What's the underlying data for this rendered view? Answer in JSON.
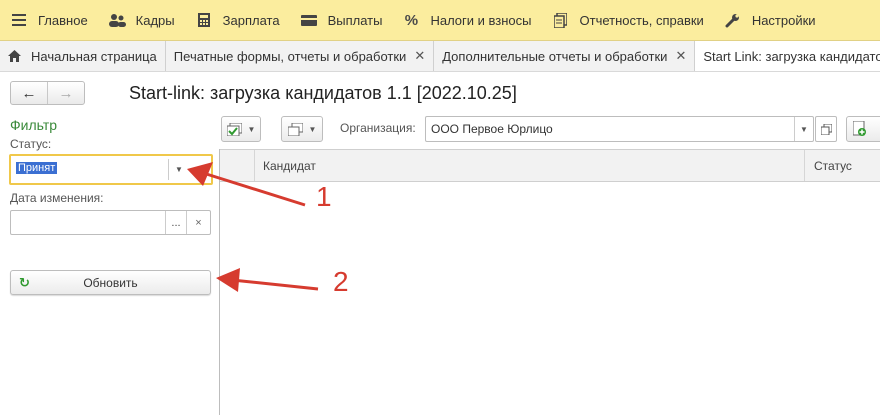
{
  "top_menu": [
    {
      "label": "Главное",
      "icon": "hamburger-icon"
    },
    {
      "label": "Кадры",
      "icon": "people-icon"
    },
    {
      "label": "Зарплата",
      "icon": "calculator-icon"
    },
    {
      "label": "Выплаты",
      "icon": "card-icon"
    },
    {
      "label": "Налоги и взносы",
      "icon": "percent-icon"
    },
    {
      "label": "Отчетность, справки",
      "icon": "documents-icon"
    },
    {
      "label": "Настройки",
      "icon": "wrench-icon"
    }
  ],
  "tabs": [
    {
      "label": "Начальная страница",
      "icon": "home-icon",
      "closable": false
    },
    {
      "label": "Печатные формы, отчеты и обработки",
      "closable": true
    },
    {
      "label": "Дополнительные отчеты и обработки",
      "closable": true
    },
    {
      "label": "Start Link: загрузка кандидатов",
      "closable": false,
      "active": true
    }
  ],
  "form": {
    "title": "Start-link: загрузка кандидатов 1.1 [2022.10.25]",
    "filter_label": "Фильтр",
    "status_label": "Статус:",
    "status_value": "Принят",
    "date_label": "Дата изменения:",
    "date_value": "",
    "refresh_label": "Обновить",
    "org_label": "Организация:",
    "org_value": "ООО Первое Юрлицо"
  },
  "table": {
    "columns": [
      "Кандидат",
      "Статус"
    ],
    "rows": []
  },
  "callouts": [
    "1",
    "2"
  ],
  "colors": {
    "menu_bg": "#fbed9e",
    "accent_green": "#3a8a3a",
    "arrow_red": "#d63b2f",
    "focus": "#f0c84a",
    "selection": "#3b6fd2"
  }
}
